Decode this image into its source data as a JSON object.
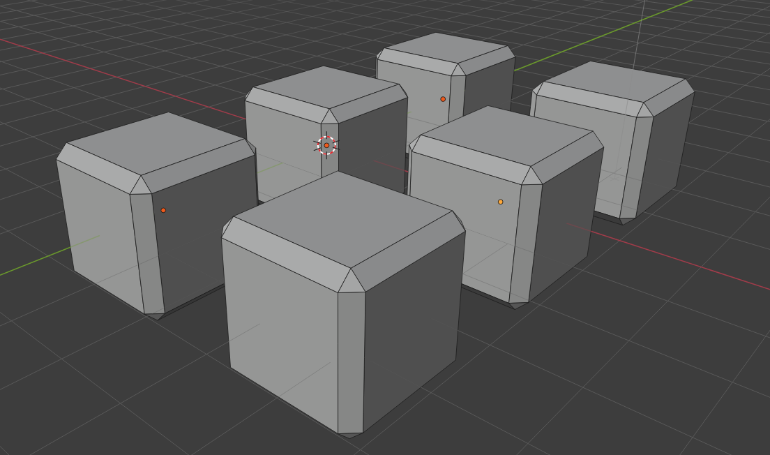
{
  "viewport": {
    "objects": [
      {
        "selected": true,
        "active": false
      },
      {
        "selected": false,
        "active": false
      },
      {
        "selected": true,
        "active": false
      },
      {
        "selected": true,
        "active": true
      },
      {
        "selected": true,
        "active": false
      },
      {
        "selected": false,
        "active": false
      }
    ]
  }
}
